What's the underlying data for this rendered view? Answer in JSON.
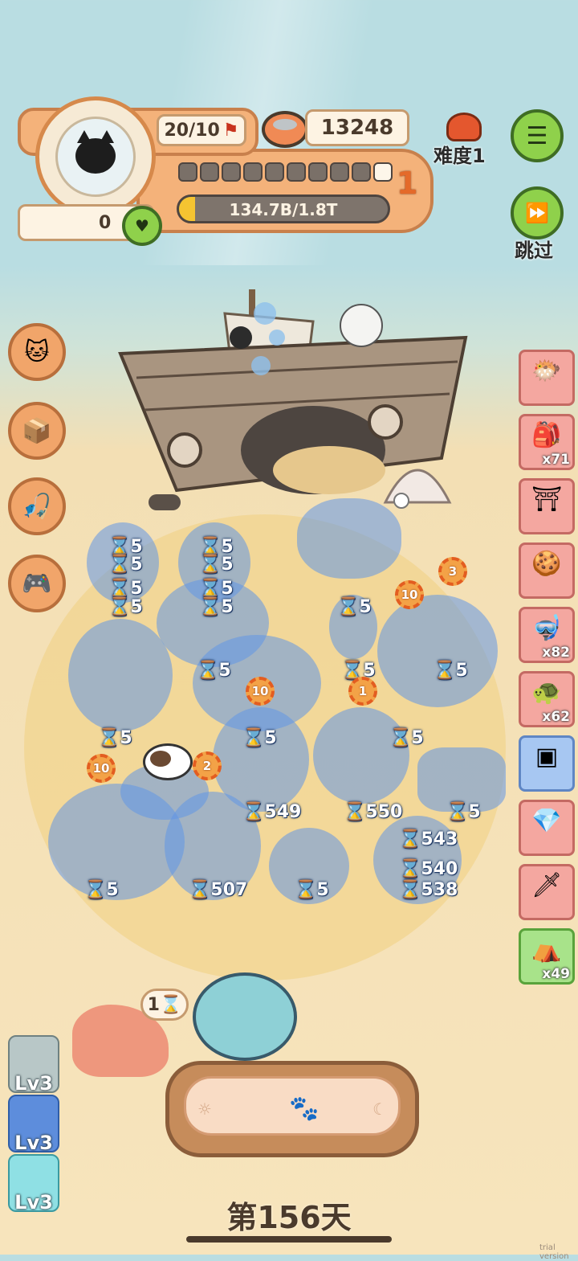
{
  "hud": {
    "population": "20/10",
    "coins": "13248",
    "difficulty": "难度1",
    "heart_count": "0",
    "progress_text": "134.7B/1.8T",
    "progress_fraction": 0.075,
    "level_segments_filled": 1,
    "level_segments_total": 10,
    "level_number": "1",
    "skip_label": "跳过"
  },
  "side_right": [
    {
      "name": "bubble-fish",
      "icon": "fish-icon",
      "glyph": "🐡",
      "count": ""
    },
    {
      "name": "gift-bag",
      "icon": "gift-bag-icon",
      "glyph": "🎒",
      "count": "x71"
    },
    {
      "name": "shrine",
      "icon": "shrine-icon",
      "glyph": "⛩",
      "count": ""
    },
    {
      "name": "gingerbread",
      "icon": "gingerbread-icon",
      "glyph": "🍪",
      "count": ""
    },
    {
      "name": "snorkel",
      "icon": "snorkel-icon",
      "glyph": "🤿",
      "count": "x82"
    },
    {
      "name": "turtle-shell",
      "icon": "shell-icon",
      "glyph": "🐢",
      "count": "x62"
    },
    {
      "name": "chest",
      "icon": "chest-icon",
      "glyph": "▣",
      "count": ""
    },
    {
      "name": "gem-ring",
      "icon": "gem-icon",
      "glyph": "💎",
      "count": ""
    },
    {
      "name": "sword",
      "icon": "sword-icon",
      "glyph": "🗡",
      "count": ""
    },
    {
      "name": "tent",
      "icon": "tent-icon",
      "glyph": "⛺",
      "count": "x49"
    }
  ],
  "side_left": [
    {
      "icon": "lucky-cat-icon",
      "glyph": "🐱"
    },
    {
      "icon": "box-icon",
      "glyph": "📦"
    },
    {
      "icon": "fishing-rod-icon",
      "glyph": "🎣"
    },
    {
      "icon": "handheld-game-icon",
      "glyph": "🎮"
    }
  ],
  "timers": [
    "5",
    "5",
    "5",
    "5",
    "5",
    "5",
    "5",
    "5",
    "5",
    "5",
    "5",
    "5",
    "5",
    "5",
    "5",
    "5",
    "5",
    "5",
    "5",
    "549",
    "550",
    "5",
    "543",
    "540",
    "538",
    "5",
    "507",
    "5"
  ],
  "coins": [
    "3",
    "10",
    "10",
    "1",
    "10",
    "2"
  ],
  "hand_timer": "1",
  "lv_cards": [
    "Lv3",
    "Lv3",
    "Lv3"
  ],
  "day_label": "第156天",
  "watermark": "trial version"
}
